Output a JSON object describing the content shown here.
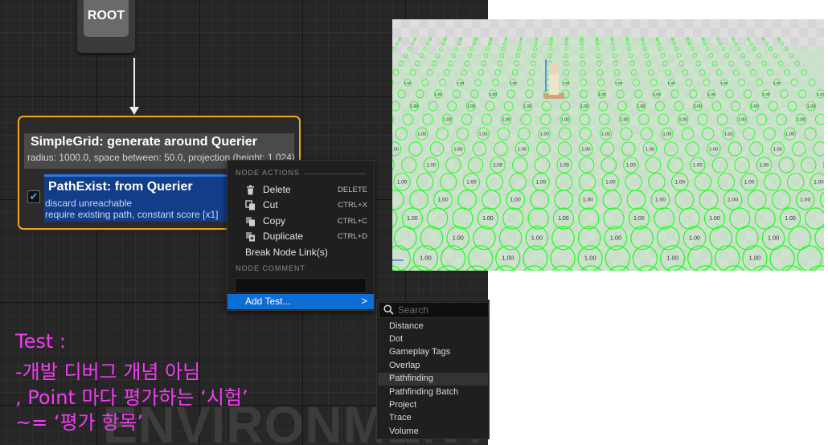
{
  "graph": {
    "watermark": "ENVIRONMENT",
    "root_label": "ROOT",
    "generator": {
      "title": "SimpleGrid: generate around Querier",
      "subtitle": "radius: 1000.0, space between: 50.0, projection (height: 1,024)"
    },
    "test_node": {
      "checked": true,
      "title": "PathExist: from Querier",
      "line1": "discard unreachable",
      "line2": "require existing path, constant score [x1]"
    }
  },
  "context_menu": {
    "section_node_actions": "NODE ACTIONS",
    "items": [
      {
        "label": "Delete",
        "shortcut": "DELETE",
        "icon": "trash-icon"
      },
      {
        "label": "Cut",
        "shortcut": "CTRL+X",
        "icon": "cut-icon"
      },
      {
        "label": "Copy",
        "shortcut": "CTRL+C",
        "icon": "copy-icon"
      },
      {
        "label": "Duplicate",
        "shortcut": "CTRL+D",
        "icon": "duplicate-icon"
      }
    ],
    "break_links": "Break Node Link(s)",
    "section_node_comment": "NODE COMMENT",
    "comment_value": "",
    "add_test": "Add Test...",
    "add_test_arrow": ">"
  },
  "submenu": {
    "search_placeholder": "Search",
    "items": [
      "Distance",
      "Dot",
      "Gameplay Tags",
      "Overlap",
      "Pathfinding",
      "Pathfinding Batch",
      "Project",
      "Trace",
      "Volume"
    ],
    "highlighted": "Pathfinding"
  },
  "annotation": {
    "line1": "Test :",
    "line2": "-개발 디버그 개념 아님",
    "line3": ", Point 마다 평가하는 ‘시험’",
    "line4": " ~= ‘평가 항목’"
  },
  "viewport": {
    "point_score_label": "1.00"
  },
  "colors": {
    "node_border": "#f0a51c",
    "test_blue": "#123d89",
    "menu_highlight": "#0c6ed4",
    "annotation": "#f23cf2",
    "debug_green": "#1aff1a"
  }
}
